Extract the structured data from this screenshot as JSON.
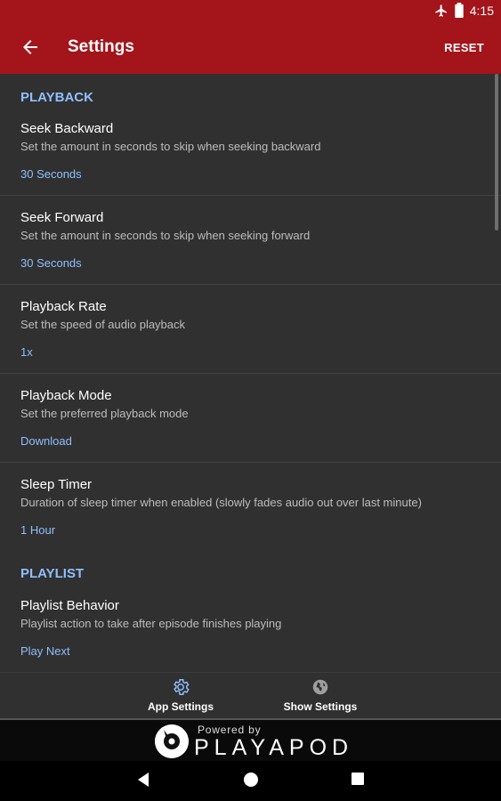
{
  "status_bar": {
    "time": "4:15",
    "icons": [
      "airplane-icon",
      "battery-icon"
    ]
  },
  "app_bar": {
    "title": "Settings",
    "reset_label": "RESET",
    "back_icon": "arrow-back-icon"
  },
  "sections": {
    "playback": {
      "header": "PLAYBACK",
      "items": [
        {
          "name": "Seek Backward",
          "description": "Set the amount in seconds to skip when seeking backward",
          "value": "30 Seconds"
        },
        {
          "name": "Seek Forward",
          "description": "Set the amount in seconds to skip when seeking forward",
          "value": "30 Seconds"
        },
        {
          "name": "Playback Rate",
          "description": "Set the speed of audio playback",
          "value": "1x"
        },
        {
          "name": "Playback Mode",
          "description": "Set the preferred playback mode",
          "value": "Download"
        },
        {
          "name": "Sleep Timer",
          "description": "Duration of sleep timer when enabled (slowly fades audio out over last minute)",
          "value": "1 Hour"
        }
      ]
    },
    "playlist": {
      "header": "PLAYLIST",
      "items": [
        {
          "name": "Playlist Behavior",
          "description": "Playlist action to take after episode finishes playing",
          "value": "Play Next"
        }
      ]
    }
  },
  "tabs": [
    {
      "label": "App Settings",
      "icon": "gear-icon",
      "selected": true
    },
    {
      "label": "Show Settings",
      "icon": "globe-icon",
      "selected": false
    }
  ],
  "footer": {
    "powered_by": "Powered by",
    "brand": "PLAYAPOD"
  },
  "colors": {
    "accent": "#a3141b",
    "link": "#8fbfff",
    "background": "#303030"
  }
}
